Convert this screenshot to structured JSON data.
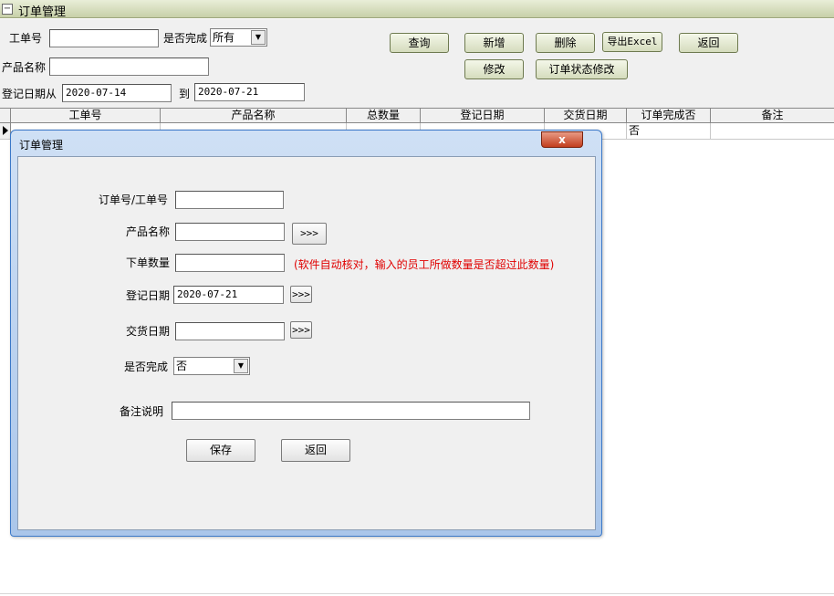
{
  "window": {
    "title": "订单管理",
    "sys_icon": "−"
  },
  "filter": {
    "work_no_label": "工单号",
    "work_no_value": "",
    "complete_label": "是否完成",
    "complete_value": "所有",
    "product_label": "产品名称",
    "product_value": "",
    "date_from_label": "登记日期从",
    "date_from_value": "2020-07-14",
    "date_to_label": "到",
    "date_to_value": "2020-07-21"
  },
  "toolbar": {
    "query": "查询",
    "add": "新增",
    "delete": "删除",
    "export": "导出Excel",
    "back": "返回",
    "edit": "修改",
    "status_edit": "订单状态修改"
  },
  "grid": {
    "columns": [
      "工单号",
      "产品名称",
      "总数量",
      "登记日期",
      "交货日期",
      "订单完成否",
      "备注"
    ],
    "row": {
      "complete": "否"
    }
  },
  "dialog": {
    "title": "订单管理",
    "close": "x",
    "order_no_label": "订单号/工单号",
    "order_no_value": "",
    "product_label": "产品名称",
    "product_value": "",
    "product_btn": ">>>",
    "qty_label": "下单数量",
    "qty_value": "",
    "qty_note": "(软件自动核对，输入的员工所做数量是否超过此数量)",
    "reg_date_label": "登记日期",
    "reg_date_value": "2020-07-21",
    "reg_date_btn": ">>>",
    "delivery_label": "交货日期",
    "delivery_value": "",
    "delivery_btn": ">>>",
    "complete_label": "是否完成",
    "complete_value": "否",
    "remark_label": "备注说明",
    "remark_value": "",
    "save": "保存",
    "back": "返回"
  },
  "icons": {
    "dropdown": "▼"
  }
}
